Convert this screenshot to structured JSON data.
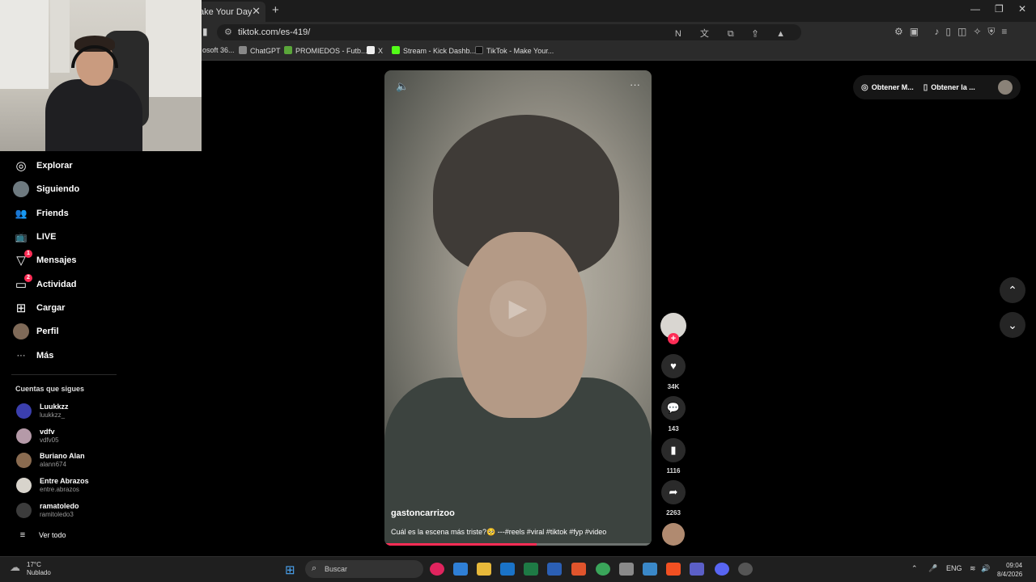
{
  "browser": {
    "tab_title": "ake Your Day",
    "tab_close": "✕",
    "new_tab": "+",
    "url": "tiktok.com/es-419/",
    "bookmarks": [
      "osoft 36...",
      "ChatGPT",
      "PROMIEDOS - Futb...",
      "X",
      "Stream - Kick Dashb...",
      "TikTok - Make Your..."
    ],
    "window_controls": [
      "—",
      "❐",
      "✕"
    ]
  },
  "sidebar": {
    "nav": [
      {
        "label": "Explorar",
        "icon": "compass-icon",
        "glyph": "◎"
      },
      {
        "label": "Siguiendo",
        "icon": "following-avatar-icon",
        "glyph": ""
      },
      {
        "label": "Friends",
        "icon": "friends-icon",
        "glyph": "👥"
      },
      {
        "label": "LIVE",
        "icon": "live-tv-icon",
        "glyph": "📺"
      },
      {
        "label": "Mensajes",
        "icon": "messages-icon",
        "glyph": "▽",
        "badge": "1"
      },
      {
        "label": "Actividad",
        "icon": "activity-icon",
        "glyph": "▭",
        "badge": "2"
      },
      {
        "label": "Cargar",
        "icon": "upload-plus-icon",
        "glyph": "⊞"
      },
      {
        "label": "Perfil",
        "icon": "profile-avatar-icon",
        "glyph": ""
      },
      {
        "label": "Más",
        "icon": "more-icon",
        "glyph": "···"
      }
    ],
    "following_title": "Cuentas que sigues",
    "accounts": [
      {
        "name": "Luukkzz",
        "handle": "luukkzz_",
        "color": "#3b3fae"
      },
      {
        "name": "vdfv",
        "handle": "vdfv05",
        "color": "#b59aa8"
      },
      {
        "name": "Buriano Alan",
        "handle": "alann674",
        "color": "#8a6b50"
      },
      {
        "name": "Entre Abrazos",
        "handle": "entre.abrazos",
        "color": "#d8d4cc"
      },
      {
        "name": "ramatoledo",
        "handle": "ramitoledo3",
        "color": "#3c3c3c"
      }
    ],
    "see_all": "Ver todo"
  },
  "top_right": {
    "get_coins": "Obtener M...",
    "get_app": "Obtener la ..."
  },
  "video": {
    "author": "gastoncarrizoo",
    "caption": "Cuál es la escena más triste?🥺 ---#reels #viral #tiktok #fyp #video",
    "progress": 0.57
  },
  "actions": {
    "likes": "34K",
    "comments": "143",
    "saves": "1116",
    "shares": "2263"
  },
  "taskbar": {
    "temperature": "17°C",
    "weather": "Nublado",
    "search_placeholder": "Buscar",
    "language": "ENG",
    "time": "09:04",
    "date": "8/4/2026"
  },
  "colors": {
    "accent": "#fe2c55",
    "background": "#000000"
  }
}
